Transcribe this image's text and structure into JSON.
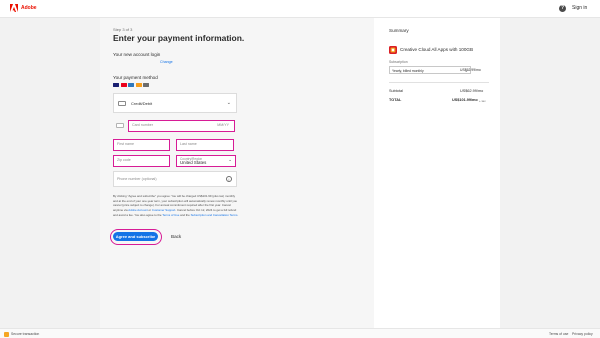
{
  "header": {
    "brand": "Adobe",
    "help_icon": "question-circle-icon",
    "signin": "Sign in"
  },
  "checkout": {
    "step": "Step 3 of 3",
    "title": "Enter your payment information.",
    "account_label": "Your new account login",
    "change_link": "Change",
    "payment_label": "Your payment method",
    "card_logos": [
      "#1a1f71",
      "#eb001b",
      "#2e77bc",
      "#f79e1b",
      "#6c6c6c"
    ],
    "method": "Credit/Debit"
  },
  "fields": {
    "card_number": "Card number",
    "card_hint": "MM/YY",
    "first_name": "First name",
    "last_name": "Last name",
    "zip": "Zip code",
    "country_label": "Country/Region",
    "country": "United States",
    "phone": "Phone number (optional)"
  },
  "legal": {
    "part1": "By clicking \"Agree and subscribe\" you agree: You will be charged US$101.99 (plus tax) monthly and at the end of your one-year term, your subscription will automatically renew monthly until you cancel (price subject to change). For annual commitment required after the first year. Cancel anytime via ",
    "link1": "Adobe Account",
    "part2": " or ",
    "link2": "Customer Support",
    "part3": ". Cancel before Oct 12, 2024 to get a full refund and avoid a fee. You also agree to the ",
    "link3": "Terms of Use",
    "part4": " and the ",
    "link4": "Subscription and Cancellation Terms",
    "part5": "."
  },
  "actions": {
    "agree": "Agree and subscribe",
    "back": "Back"
  },
  "summary": {
    "title": "Summary",
    "product": "Creative Cloud All Apps with 100GB",
    "subscription_label": "Subscription",
    "subscription_value": "Yearly, billed monthly",
    "subscription_price": "US$62.99/mo",
    "subtotal_label": "Subtotal",
    "subtotal_value": "US$62.99/mo",
    "total_label": "TOTAL",
    "total_value": "US$101.99/mo",
    "total_suffix": "+ tax"
  },
  "footer": {
    "left": "Secure transaction",
    "right1": "Terms of use",
    "right2": "Privacy policy"
  }
}
